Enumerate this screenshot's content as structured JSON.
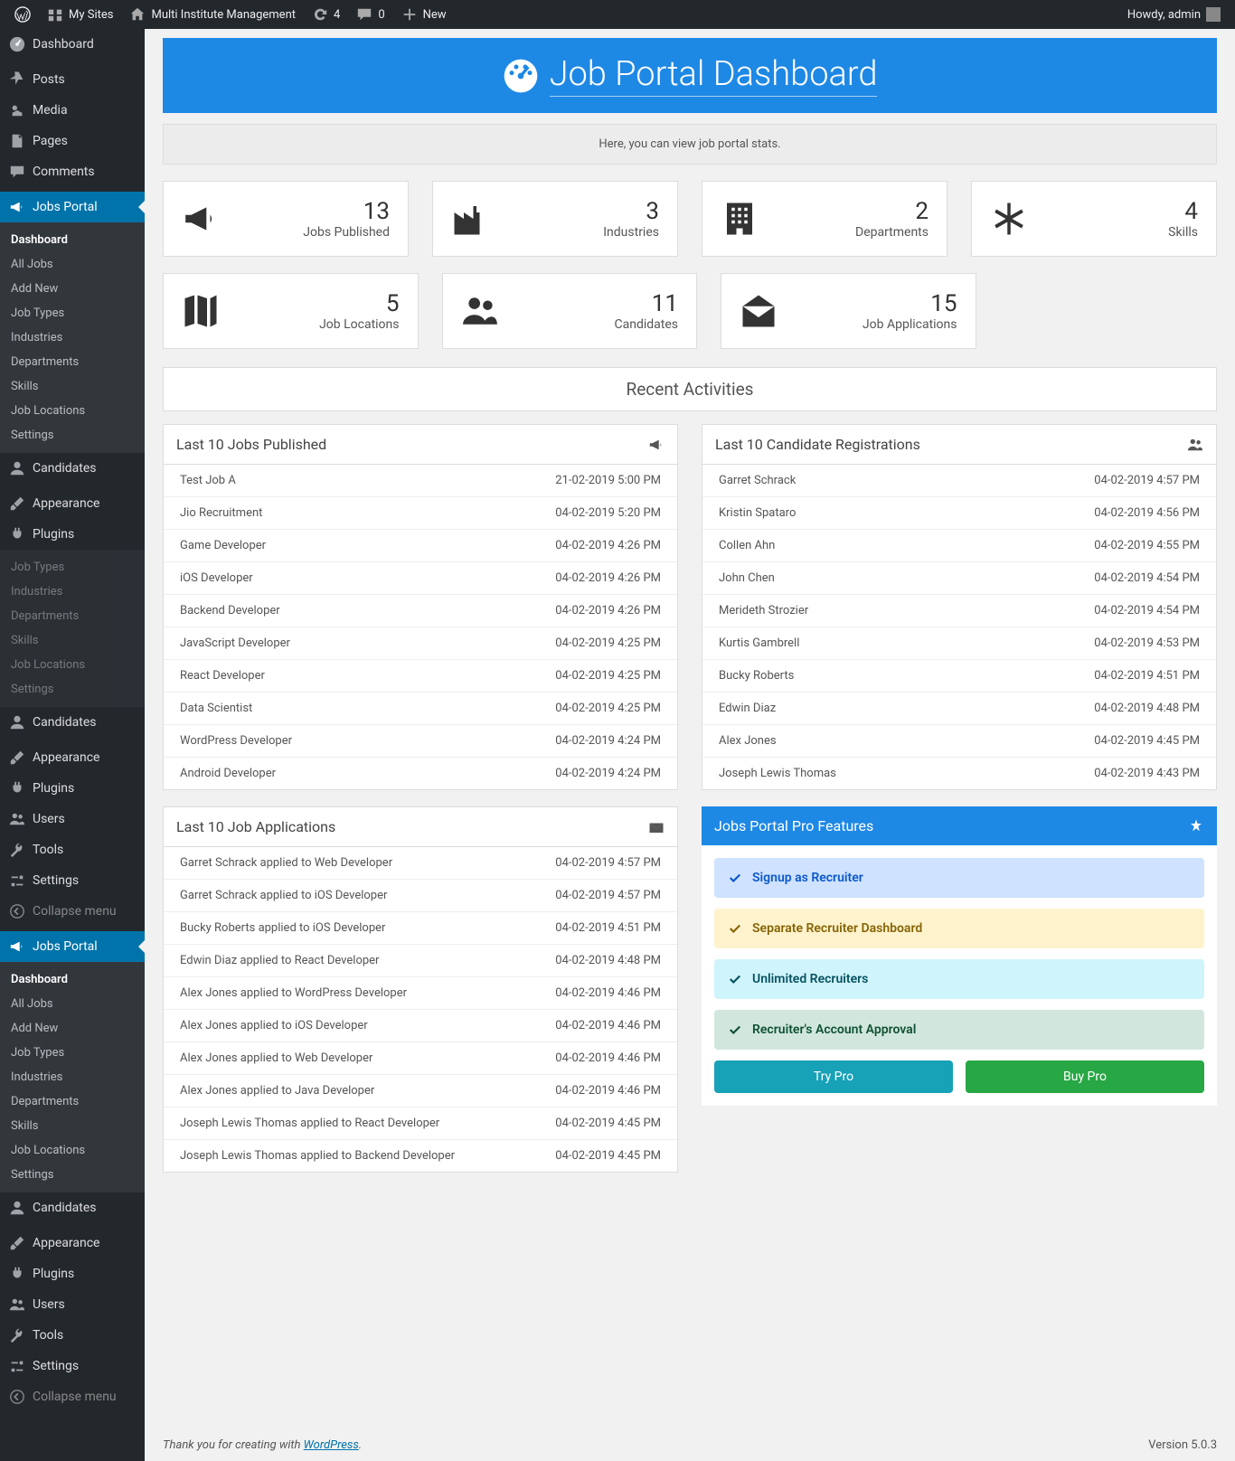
{
  "adminbar": {
    "mysites": "My Sites",
    "sitename": "Multi Institute Management",
    "updates": "4",
    "comments": "0",
    "new": "New",
    "howdy": "Howdy, admin"
  },
  "sidebar": {
    "dashboard": "Dashboard",
    "posts": "Posts",
    "media": "Media",
    "pages": "Pages",
    "comments": "Comments",
    "jobsportal": "Jobs Portal",
    "candidates": "Candidates",
    "appearance": "Appearance",
    "plugins": "Plugins",
    "users": "Users",
    "tools": "Tools",
    "settings": "Settings",
    "collapse": "Collapse menu",
    "sub": {
      "dashboard": "Dashboard",
      "alljobs": "All Jobs",
      "addnew": "Add New",
      "jobtypes": "Job Types",
      "industries": "Industries",
      "departments": "Departments",
      "skills": "Skills",
      "joblocations": "Job Locations",
      "settings": "Settings"
    }
  },
  "page": {
    "title": "Job Portal Dashboard",
    "subtitle": "Here, you can view job portal stats.",
    "recent": "Recent Activities"
  },
  "stats": [
    {
      "value": "13",
      "label": "Jobs Published"
    },
    {
      "value": "3",
      "label": "Industries"
    },
    {
      "value": "2",
      "label": "Departments"
    },
    {
      "value": "4",
      "label": "Skills"
    },
    {
      "value": "5",
      "label": "Job Locations"
    },
    {
      "value": "11",
      "label": "Candidates"
    },
    {
      "value": "15",
      "label": "Job Applications"
    }
  ],
  "panels": {
    "jobs_title": "Last 10 Jobs Published",
    "cands_title": "Last 10 Candidate Registrations",
    "apps_title": "Last 10 Job Applications",
    "pro_title": "Jobs Portal Pro Features"
  },
  "jobs": [
    {
      "name": "Test Job A",
      "date": "21-02-2019 5:00 PM"
    },
    {
      "name": "Jio Recruitment",
      "date": "04-02-2019 5:20 PM"
    },
    {
      "name": "Game Developer",
      "date": "04-02-2019 4:26 PM"
    },
    {
      "name": "iOS Developer",
      "date": "04-02-2019 4:26 PM"
    },
    {
      "name": "Backend Developer",
      "date": "04-02-2019 4:26 PM"
    },
    {
      "name": "JavaScript Developer",
      "date": "04-02-2019 4:25 PM"
    },
    {
      "name": "React Developer",
      "date": "04-02-2019 4:25 PM"
    },
    {
      "name": "Data Scientist",
      "date": "04-02-2019 4:25 PM"
    },
    {
      "name": "WordPress Developer",
      "date": "04-02-2019 4:24 PM"
    },
    {
      "name": "Android Developer",
      "date": "04-02-2019 4:24 PM"
    }
  ],
  "candidates": [
    {
      "name": "Garret Schrack",
      "date": "04-02-2019 4:57 PM"
    },
    {
      "name": "Kristin Spataro",
      "date": "04-02-2019 4:56 PM"
    },
    {
      "name": "Collen Ahn",
      "date": "04-02-2019 4:55 PM"
    },
    {
      "name": "John Chen",
      "date": "04-02-2019 4:54 PM"
    },
    {
      "name": "Merideth Strozier",
      "date": "04-02-2019 4:54 PM"
    },
    {
      "name": "Kurtis Gambrell",
      "date": "04-02-2019 4:53 PM"
    },
    {
      "name": "Bucky Roberts",
      "date": "04-02-2019 4:51 PM"
    },
    {
      "name": "Edwin Diaz",
      "date": "04-02-2019 4:48 PM"
    },
    {
      "name": "Alex Jones",
      "date": "04-02-2019 4:45 PM"
    },
    {
      "name": "Joseph Lewis Thomas",
      "date": "04-02-2019 4:43 PM"
    }
  ],
  "applications": [
    {
      "name": "Garret Schrack applied to Web Developer",
      "date": "04-02-2019 4:57 PM"
    },
    {
      "name": "Garret Schrack applied to iOS Developer",
      "date": "04-02-2019 4:57 PM"
    },
    {
      "name": "Bucky Roberts applied to iOS Developer",
      "date": "04-02-2019 4:51 PM"
    },
    {
      "name": "Edwin Diaz applied to React Developer",
      "date": "04-02-2019 4:48 PM"
    },
    {
      "name": "Alex Jones applied to WordPress Developer",
      "date": "04-02-2019 4:46 PM"
    },
    {
      "name": "Alex Jones applied to iOS Developer",
      "date": "04-02-2019 4:46 PM"
    },
    {
      "name": "Alex Jones applied to Web Developer",
      "date": "04-02-2019 4:46 PM"
    },
    {
      "name": "Alex Jones applied to Java Developer",
      "date": "04-02-2019 4:46 PM"
    },
    {
      "name": "Joseph Lewis Thomas applied to React Developer",
      "date": "04-02-2019 4:45 PM"
    },
    {
      "name": "Joseph Lewis Thomas applied to Backend Developer",
      "date": "04-02-2019 4:45 PM"
    }
  ],
  "pro": {
    "features": [
      "Signup as Recruiter",
      "Separate Recruiter Dashboard",
      "Unlimited Recruiters",
      "Recruiter's Account Approval"
    ],
    "try": "Try Pro",
    "buy": "Buy Pro"
  },
  "footer": {
    "text": "Thank you for creating with ",
    "link": "WordPress",
    "period": ".",
    "version": "Version 5.0.3"
  }
}
